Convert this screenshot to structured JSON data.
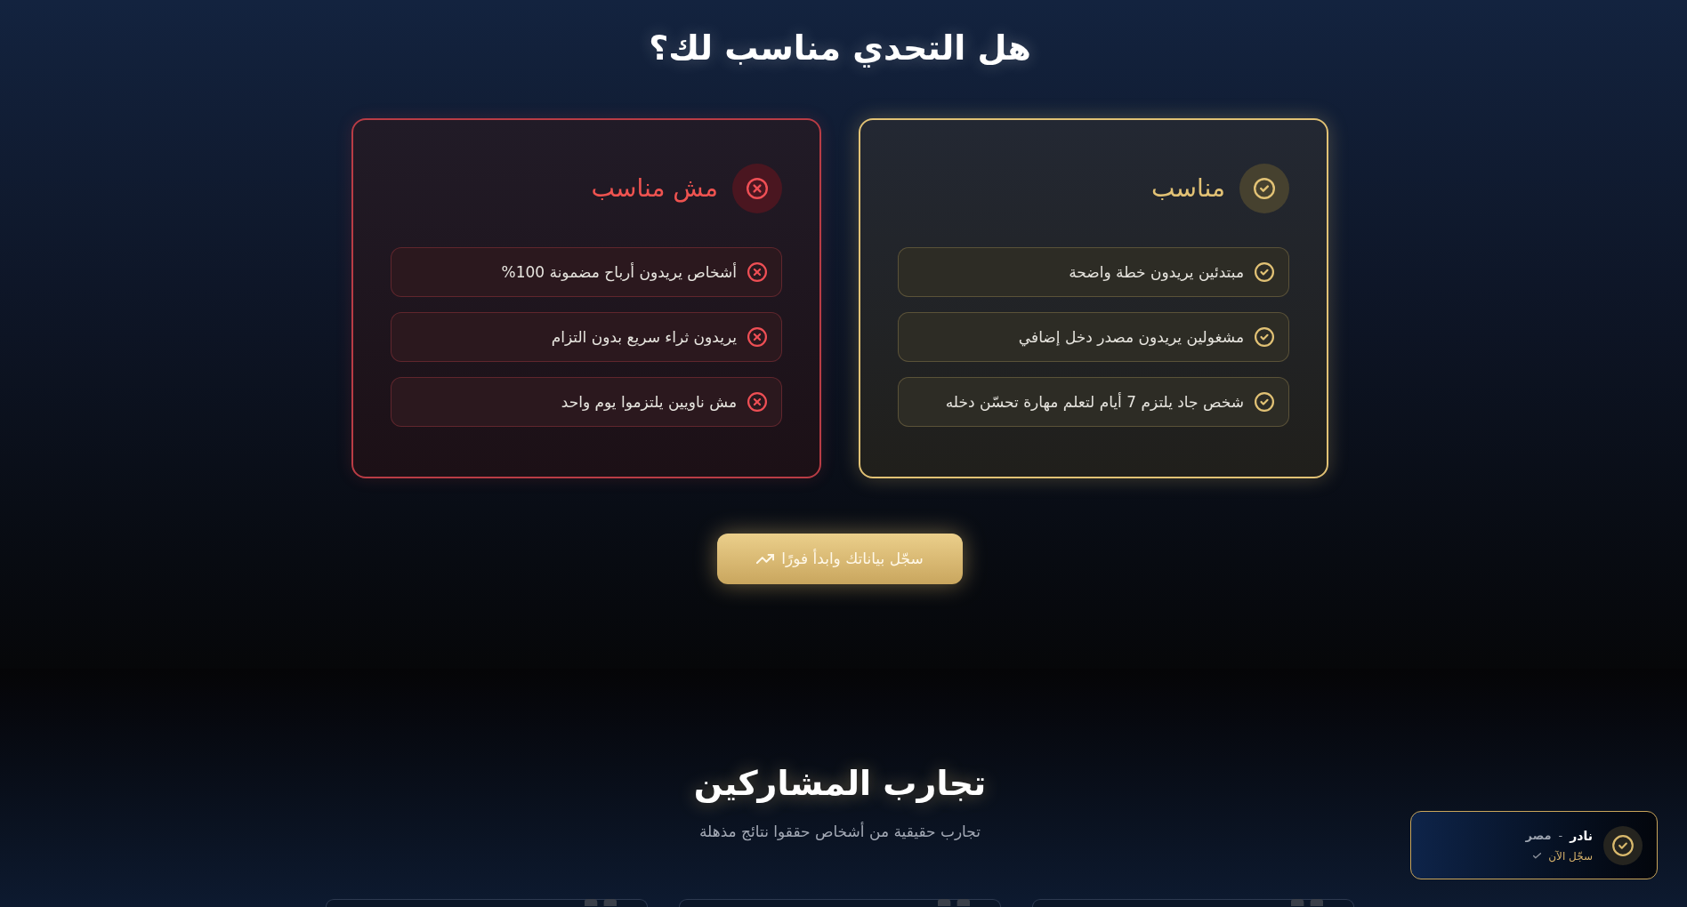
{
  "fit_section": {
    "title": "هل التحدي مناسب لك؟",
    "columns": [
      {
        "kind": "fit",
        "heading": "مناسب",
        "items": [
          "مبتدئين يريدون خطة واضحة",
          "مشغولين يريدون مصدر دخل إضافي",
          "شخص جاد يلتزم 7 أيام لتعلم مهارة تحسّن دخله"
        ]
      },
      {
        "kind": "not_fit",
        "heading": "مش مناسب",
        "items": [
          "أشخاص يريدون أرباح مضمونة 100%",
          "يريدون ثراء سريع بدون التزام",
          "مش ناويين يلتزموا يوم واحد"
        ]
      }
    ],
    "cta_button": {
      "label": "سجّل بياناتك وابدأ فورًا"
    }
  },
  "testimonials_section": {
    "title": "تجارب المشاركين",
    "subtitle": "تجارب حقيقية من أشخاص حققوا نتائج مذهلة",
    "cards": [
      {
        "kind": "quote"
      },
      {
        "kind": "quote"
      },
      {
        "kind": "quote"
      }
    ]
  },
  "notification": {
    "name": "نادر",
    "separator": "-",
    "location": "مصر",
    "action": "سجّل الآن"
  }
}
